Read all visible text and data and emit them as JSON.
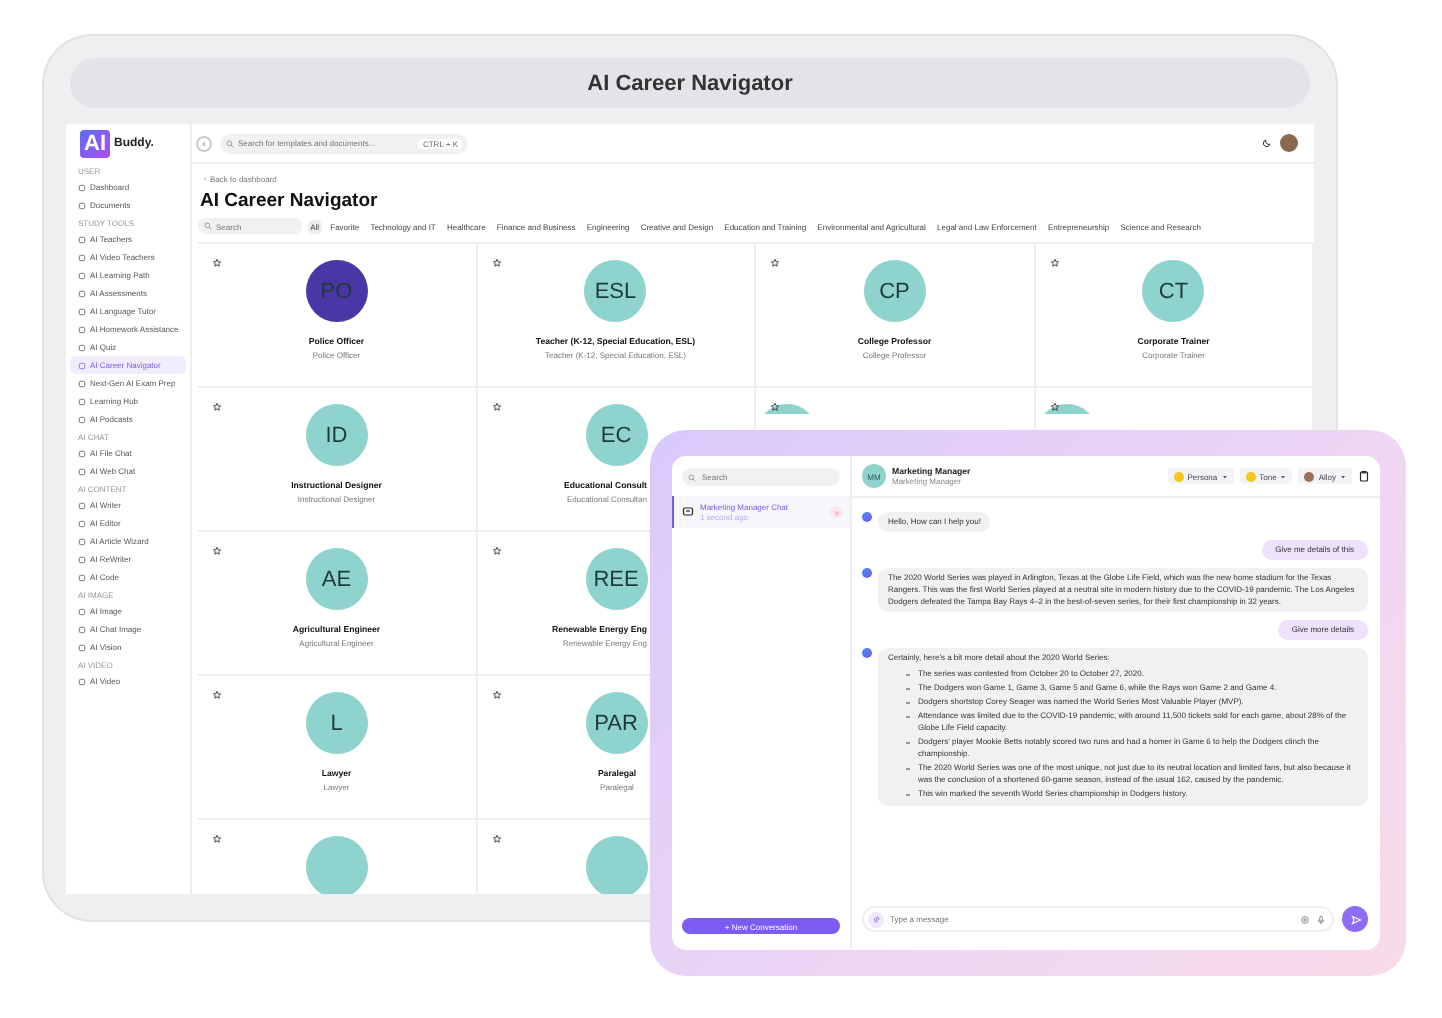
{
  "frame_title": "AI Career Navigator",
  "sidebar": {
    "logo": {
      "badge": "AI",
      "name": "Buddy."
    },
    "sections": [
      {
        "heading": "USER",
        "items": [
          {
            "label": "Dashboard",
            "selected": false
          },
          {
            "label": "Documents",
            "selected": false
          }
        ]
      },
      {
        "heading": "STUDY TOOLS",
        "items": [
          {
            "label": "AI Teachers",
            "selected": false
          },
          {
            "label": "AI Video Teachers",
            "selected": false
          },
          {
            "label": "AI Learning Path",
            "selected": false
          },
          {
            "label": "AI Assessments",
            "selected": false
          },
          {
            "label": "AI Language Tutor",
            "selected": false
          },
          {
            "label": "AI Homework Assistance",
            "selected": false
          },
          {
            "label": "AI Quiz",
            "selected": false
          },
          {
            "label": "AI Career Navigator",
            "selected": true
          },
          {
            "label": "Next-Gen AI Exam Prep",
            "selected": false
          },
          {
            "label": "Learning Hub",
            "selected": false
          },
          {
            "label": "AI Podcasts",
            "selected": false
          }
        ]
      },
      {
        "heading": "AI CHAT",
        "items": [
          {
            "label": "AI File Chat",
            "selected": false
          },
          {
            "label": "AI Web Chat",
            "selected": false
          }
        ]
      },
      {
        "heading": "AI CONTENT",
        "items": [
          {
            "label": "AI Writer",
            "selected": false
          },
          {
            "label": "AI Editor",
            "selected": false
          },
          {
            "label": "AI Article Wizard",
            "selected": false
          },
          {
            "label": "AI ReWriter",
            "selected": false
          },
          {
            "label": "AI Code",
            "selected": false
          }
        ]
      },
      {
        "heading": "AI IMAGE",
        "items": [
          {
            "label": "AI Image",
            "selected": false
          },
          {
            "label": "AI Chat Image",
            "selected": false
          },
          {
            "label": "AI Vision",
            "selected": false
          }
        ]
      },
      {
        "heading": "AI VIDEO",
        "items": [
          {
            "label": "AI Video",
            "selected": false
          }
        ]
      }
    ]
  },
  "topbar": {
    "search": {
      "placeholder": "Search for templates and documents..."
    },
    "shortcut": "CTRL + K"
  },
  "back_link": "Back to dashboard",
  "page_title": "AI Career Navigator",
  "filter": {
    "search": {
      "placeholder": "Search"
    },
    "categories": [
      {
        "label": "All",
        "selected": true
      },
      {
        "label": "Favorite",
        "selected": false
      },
      {
        "label": "Technology and IT",
        "selected": false
      },
      {
        "label": "Healthcare",
        "selected": false
      },
      {
        "label": "Finance and Business",
        "selected": false
      },
      {
        "label": "Engineering",
        "selected": false
      },
      {
        "label": "Creative and Design",
        "selected": false
      },
      {
        "label": "Education and Training",
        "selected": false
      },
      {
        "label": "Environmental and Agricultural",
        "selected": false
      },
      {
        "label": "Legal and Law Enforcement",
        "selected": false
      },
      {
        "label": "Entrepreneurship",
        "selected": false
      },
      {
        "label": "Science and Research",
        "selected": false
      }
    ]
  },
  "card_rows": [
    [
      {
        "kind": "full",
        "initials": "PO",
        "color": "#4b36a6",
        "title": "Police Officer",
        "subtitle": "Police Officer"
      },
      {
        "kind": "full",
        "initials": "ESL",
        "color": "#8fd3ce",
        "title": "Teacher (K-12, Special Education, ESL)",
        "subtitle": "Teacher (K-12, Special Education, ESL)"
      },
      {
        "kind": "full",
        "initials": "CP",
        "color": "#8fd3ce",
        "title": "College Professor",
        "subtitle": "College Professor"
      },
      {
        "kind": "full",
        "initials": "CT",
        "color": "#8fd3ce",
        "title": "Corporate Trainer",
        "subtitle": "Corporate Trainer"
      }
    ],
    [
      {
        "kind": "full",
        "initials": "ID",
        "color": "#8fd3ce",
        "title": "Instructional Designer",
        "subtitle": "Instructional Designer"
      },
      {
        "kind": "cut",
        "initials": "EC",
        "color": "#8fd3ce",
        "title": "Educational Consult",
        "subtitle": "Educational Consultan"
      },
      {
        "kind": "covered",
        "color": "#8fd3ce"
      },
      {
        "kind": "covered",
        "color": "#8fd3ce"
      }
    ],
    [
      {
        "kind": "full",
        "initials": "AE",
        "color": "#8fd3ce",
        "title": "Agricultural Engineer",
        "subtitle": "Agricultural Engineer"
      },
      {
        "kind": "cut",
        "initials": "REE",
        "color": "#8fd3ce",
        "title": "Renewable Energy Eng",
        "subtitle": "Renewable Energy Eng"
      }
    ],
    [
      {
        "kind": "full",
        "initials": "L",
        "color": "#8fd3ce",
        "title": "Lawyer",
        "subtitle": "Lawyer"
      },
      {
        "kind": "full",
        "initials": "PAR",
        "color": "#8fd3ce",
        "title": "Paralegal",
        "subtitle": "Paralegal"
      }
    ],
    [
      {
        "kind": "edge",
        "color": "#8fd3ce"
      },
      {
        "kind": "edge",
        "color": "#8fd3ce"
      }
    ]
  ],
  "chat": {
    "search": {
      "placeholder": "Search"
    },
    "conversations": [
      {
        "title": "Marketing Manager Chat",
        "time": "1 second ago",
        "selected": true
      }
    ],
    "new_button": "+ New Conversation",
    "header": {
      "initials": "MM",
      "name": "Marketing Manager",
      "role": "Marketing Manager"
    },
    "selectors": [
      {
        "kind": "emoji",
        "label": "Persona"
      },
      {
        "kind": "emoji",
        "label": "Tone"
      },
      {
        "kind": "avatar",
        "label": "Alloy"
      }
    ],
    "messages": [
      {
        "kind": "bot",
        "text": "Hello, How can I help you!"
      },
      {
        "kind": "user",
        "text": "Give me details of this"
      },
      {
        "kind": "bot",
        "text": "The 2020 World Series was played in Arlington, Texas at the Globe Life Field, which was the new home stadium for the Texas Rangers. This was the first World Series played at a neutral site in modern history due to the COVID-19 pandemic. The Los Angeles Dodgers defeated the Tampa Bay Rays 4–2 in the best-of-seven series, for their first championship in 32 years."
      },
      {
        "kind": "user",
        "text": "Give more details"
      },
      {
        "kind": "bot",
        "text": "Certainly, here's a bit more detail about the 2020 World Series:",
        "bullets": [
          "The series was contested from October 20 to October 27, 2020.",
          "The Dodgers won Game 1, Game 3, Game 5 and Game 6, while the Rays won Game 2 and Game 4.",
          "Dodgers shortstop Corey Seager was named the World Series Most Valuable Player (MVP).",
          "Attendance was limited due to the COVID-19 pandemic, with around 11,500 tickets sold for each game, about 28% of the Globe Life Field capacity.",
          "Dodgers' player Mookie Betts notably scored two runs and had a homer in Game 6 to help the Dodgers clinch the championship.",
          "The 2020 World Series was one of the most unique, not just due to its neutral location and limited fans, but also because it was the conclusion of a shortened 60-game season, instead of the usual 162, caused by the pandemic.",
          "This win marked the seventh World Series championship in Dodgers history."
        ]
      }
    ],
    "input": {
      "placeholder": "Type a message"
    }
  }
}
